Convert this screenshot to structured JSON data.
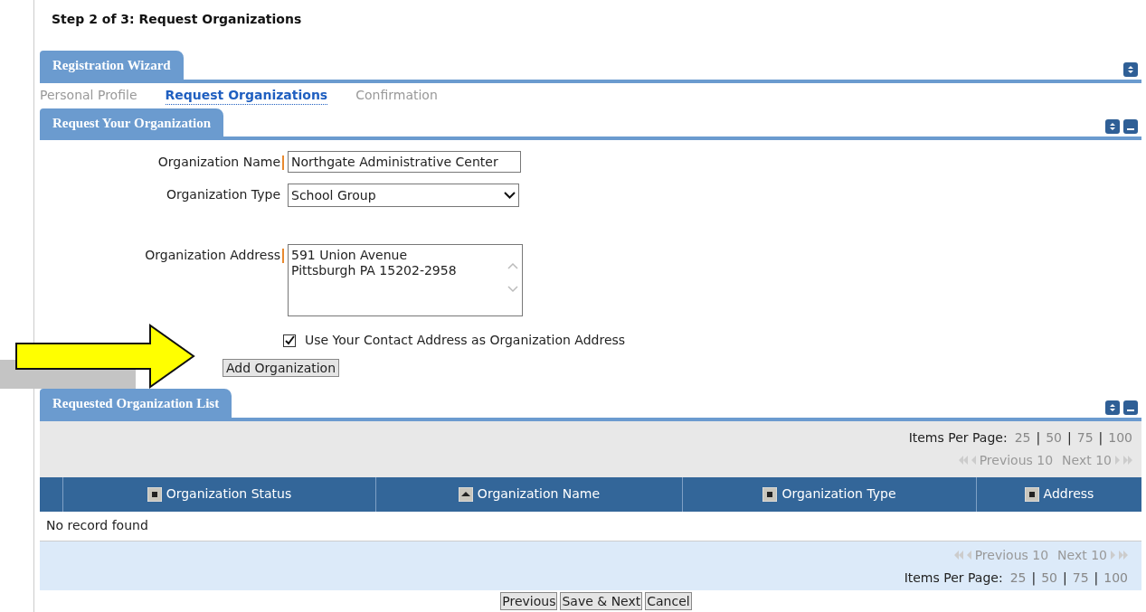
{
  "page_title": "Step 2 of 3: Request Organizations",
  "wizard": {
    "title": "Registration Wizard",
    "steps": [
      {
        "label": "Personal Profile",
        "selected": false
      },
      {
        "label": "Request Organizations",
        "selected": true
      },
      {
        "label": "Confirmation",
        "selected": false
      }
    ]
  },
  "request_panel": {
    "title": "Request Your Organization",
    "fields": [
      {
        "kind": "text",
        "label": "Organization Name",
        "required": true,
        "value": "Northgate Administrative Center"
      },
      {
        "kind": "select",
        "label": "Organization Type",
        "required": false,
        "value": "School Group"
      },
      {
        "kind": "textarea",
        "label": "Organization Address",
        "required": true,
        "value": "591 Union Avenue\nPittsburgh PA 15202-2958"
      }
    ],
    "checkbox": {
      "label": "Use Your Contact Address as Organization Address",
      "checked": true
    },
    "add_button": "Add Organization"
  },
  "list_panel": {
    "title": "Requested Organization List",
    "top_bar": {
      "items_per_page": {
        "label": "Items Per Page:",
        "options": [
          "25",
          "50",
          "75",
          "100"
        ],
        "separator": "|"
      },
      "pager": {
        "previous": "Previous 10",
        "next": "Next 10"
      }
    },
    "columns": [
      {
        "label": "Organization Status",
        "sorted": false
      },
      {
        "label": "Organization Name",
        "sorted": true
      },
      {
        "label": "Organization Type",
        "sorted": false
      },
      {
        "label": "Address",
        "sorted": false
      }
    ],
    "empty_message": "No record found",
    "bottom_bar": {
      "pager": {
        "previous": "Previous 10",
        "next": "Next 10"
      },
      "items_per_page": {
        "label": "Items Per Page:",
        "options": [
          "25",
          "50",
          "75",
          "100"
        ],
        "separator": "|"
      }
    }
  },
  "buttons": [
    "Previous",
    "Save & Next",
    "Cancel"
  ],
  "annotation": {
    "kind": "arrow"
  }
}
